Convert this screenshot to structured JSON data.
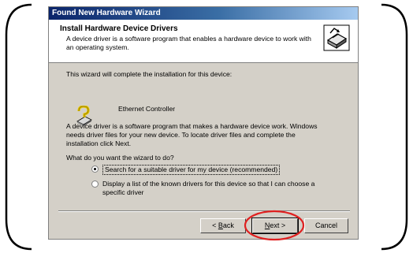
{
  "window": {
    "title": "Found New Hardware Wizard"
  },
  "header": {
    "title": "Install Hardware Device Drivers",
    "subtitle": "A device driver is a software program that enables a hardware device to work with an operating system."
  },
  "body": {
    "intro": "This wizard will complete the installation for this device:",
    "device_name": "Ethernet Controller",
    "description": "A device driver is a software program that makes a hardware device work. Windows needs driver files for your new device. To locate driver files and complete the installation click Next.",
    "question": "What do you want the wizard to do?"
  },
  "options": [
    {
      "label": "Search for a suitable driver for my device (recommended)",
      "selected": true
    },
    {
      "label": "Display a list of the known drivers for this device so that I can choose a specific driver",
      "selected": false
    }
  ],
  "buttons": {
    "back": {
      "accel": "B",
      "rest": "ack",
      "prefix": "< "
    },
    "next": {
      "accel": "N",
      "rest": "ext",
      "suffix": " >"
    },
    "cancel": "Cancel"
  },
  "annotation": {
    "highlight_color": "#e02020",
    "target": "next-button"
  },
  "icons": {
    "header": "hardware-wizard-icon",
    "device": "question-hardware-icon"
  }
}
